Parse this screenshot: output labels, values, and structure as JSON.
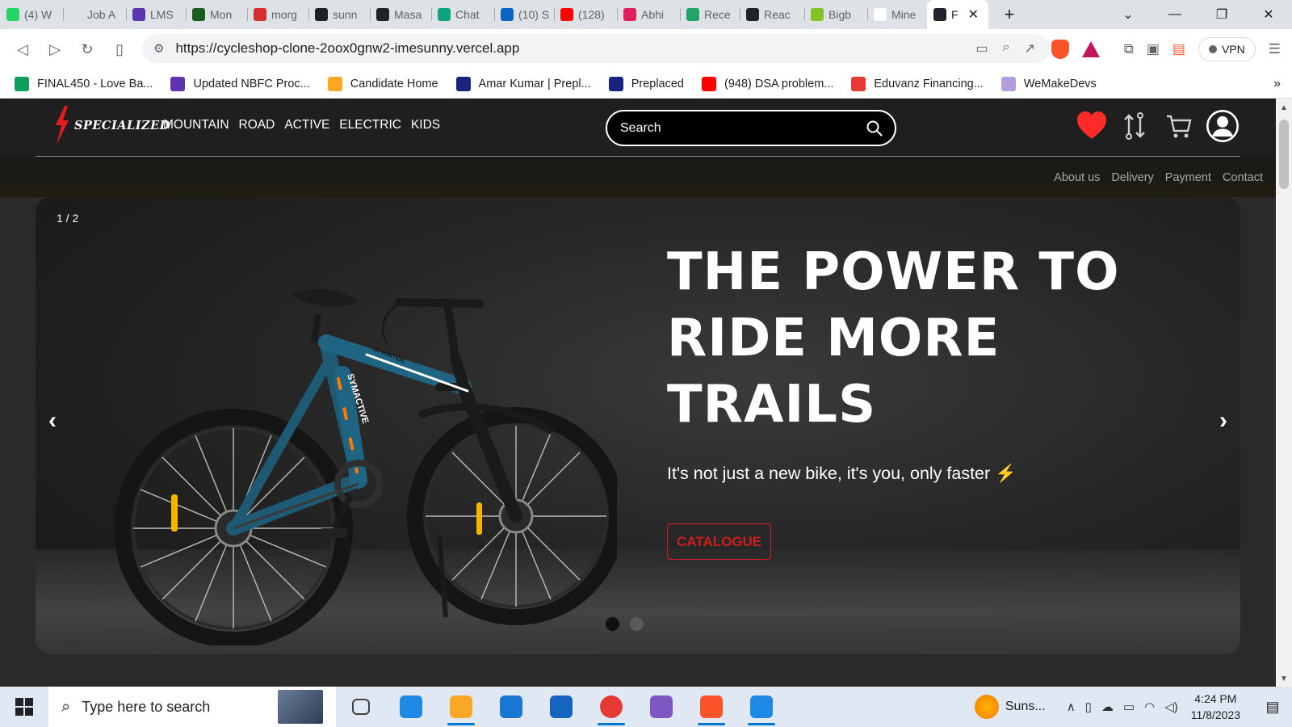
{
  "browser": {
    "tabs": [
      {
        "label": "(4) W",
        "icon": "whatsapp-icon",
        "color": "#25d366"
      },
      {
        "label": "Job A",
        "icon": "job-icon",
        "color": "#dee1e6"
      },
      {
        "label": "LMS",
        "icon": "lms-icon",
        "color": "#5e35b1"
      },
      {
        "label": "Mon",
        "icon": "mongodb-icon",
        "color": "#1b5e20"
      },
      {
        "label": "morg",
        "icon": "morgan-icon",
        "color": "#d32f2f"
      },
      {
        "label": "sunn",
        "icon": "github-icon",
        "color": "#202124"
      },
      {
        "label": "Masa",
        "icon": "masai-icon",
        "color": "#202124"
      },
      {
        "label": "Chat",
        "icon": "chatgpt-icon",
        "color": "#10a37f"
      },
      {
        "label": "(10) S",
        "icon": "linkedin-icon",
        "color": "#0a66c2"
      },
      {
        "label": "(128)",
        "icon": "youtube-icon",
        "color": "#ff0000"
      },
      {
        "label": "Abhi",
        "icon": "slack-icon",
        "color": "#e01e5a"
      },
      {
        "label": "Rece",
        "icon": "google-drive-icon",
        "color": "#1fa463"
      },
      {
        "label": "Reac",
        "icon": "react-icon",
        "color": "#20232a"
      },
      {
        "label": "Bigb",
        "icon": "bigbasket-icon",
        "color": "#84c225"
      },
      {
        "label": "Mine",
        "icon": "wikipedia-icon",
        "color": "#ffffff"
      },
      {
        "label": "F",
        "icon": "react-icon",
        "color": "#20232a",
        "active": true
      }
    ],
    "new_tab": "+",
    "url": "https://cycleshop-clone-2oox0gnw2-imesunny.vercel.app",
    "vpn_label": "VPN",
    "bookmarks": [
      {
        "label": "FINAL450 - Love Ba...",
        "icon": "google-sheets-icon",
        "color": "#0f9d58"
      },
      {
        "label": "Updated NBFC Proc...",
        "icon": "forms-icon",
        "color": "#5e35b1"
      },
      {
        "label": "Candidate Home",
        "icon": "candidate-icon",
        "color": "#f9a825"
      },
      {
        "label": "Amar Kumar | Prepl...",
        "icon": "preplaced-icon",
        "color": "#1a237e"
      },
      {
        "label": "Preplaced",
        "icon": "preplaced-icon",
        "color": "#1a237e"
      },
      {
        "label": "(948) DSA problem...",
        "icon": "youtube-icon",
        "color": "#ff0000"
      },
      {
        "label": "Eduvanz Financing...",
        "icon": "eduvanz-icon",
        "color": "#e53935"
      },
      {
        "label": "WeMakeDevs",
        "icon": "wemakedevs-icon",
        "color": "#b39ddb"
      }
    ]
  },
  "site": {
    "brand": "SPECIALIZED",
    "nav": [
      "MOUNTAIN",
      "ROAD",
      "ACTIVE",
      "ELECTRIC",
      "KIDS"
    ],
    "search_placeholder": "Search",
    "sub_links": [
      "About us",
      "Delivery",
      "Payment",
      "Contact"
    ],
    "accent_color": "#ff2b2b",
    "hero": {
      "counter": "1 / 2",
      "headline": "THE POWER TO RIDE MORE TRAILS",
      "tagline": "It's not just a new bike, it's you, only faster ⚡",
      "cta": "CATALOGUE",
      "cta_color": "#d11d1d",
      "bike_frame_text": "SYMACTIVE",
      "bike_badge_text": "SPRINTER",
      "slides_total": 2,
      "active_slide": 1
    }
  },
  "taskbar": {
    "search_placeholder": "Type here to search",
    "apps": [
      "task-view-icon",
      "edge-icon",
      "file-explorer-icon",
      "mail-icon",
      "azure-data-studio-icon",
      "chrome-icon",
      "app-icon",
      "brave-icon",
      "vscode-icon"
    ],
    "weather": "Suns...",
    "time": "4:24 PM",
    "date": "11/8/2023"
  }
}
